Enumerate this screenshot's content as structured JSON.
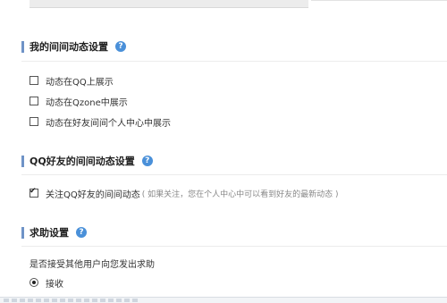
{
  "sections": {
    "feed": {
      "title": "我的间间动态设置",
      "help": "?",
      "options": [
        {
          "label": "动态在QQ上展示",
          "checked": false
        },
        {
          "label": "动态在Qzone中展示",
          "checked": false
        },
        {
          "label": "动态在好友间间个人中心中展示",
          "checked": false
        }
      ]
    },
    "qqfriends": {
      "title": "QQ好友的间间动态设置",
      "help": "?",
      "option": {
        "label": "关注QQ好友的间间动态",
        "hint": "( 如果关注，您在个人中心中可以看到好友的最新动态 )",
        "checked": true
      }
    },
    "help": {
      "title": "求助设置",
      "help": "?",
      "question": "是否接受其他用户向您发出求助",
      "radio": {
        "label": "接收",
        "selected": true
      }
    }
  },
  "colors": {
    "accent_bar": "#6f93c7",
    "help_icon": "#4a90d9"
  }
}
